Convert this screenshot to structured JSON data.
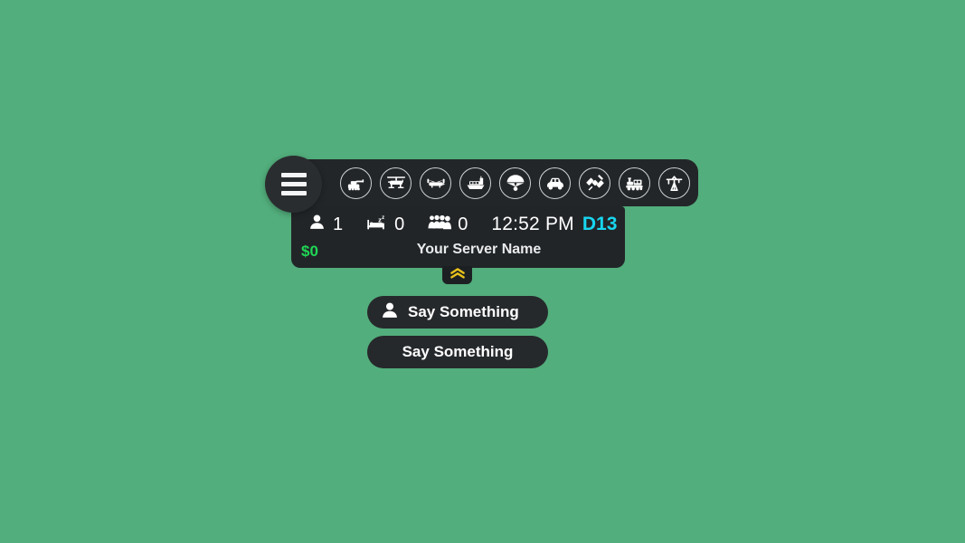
{
  "theme": {
    "background": "#52ae7c",
    "panel": "#232629",
    "panel_dark": "#222528",
    "accent_cyan": "#18d6ef",
    "accent_green": "#1fd655",
    "accent_yellow": "#e8c21a",
    "text": "#ffffff"
  },
  "menu": {
    "name": "hamburger-menu",
    "label": "Menu"
  },
  "topbar": {
    "items": [
      {
        "icon": "tank-icon",
        "label": "Tank"
      },
      {
        "icon": "helicopter-icon",
        "label": "Helicopter"
      },
      {
        "icon": "transport-helicopter-icon",
        "label": "Transport Helicopter"
      },
      {
        "icon": "ship-icon",
        "label": "Ship"
      },
      {
        "icon": "parachute-icon",
        "label": "Parachute"
      },
      {
        "icon": "car-icon",
        "label": "Car"
      },
      {
        "icon": "satellite-icon",
        "label": "Satellite"
      },
      {
        "icon": "train-icon",
        "label": "Train"
      },
      {
        "icon": "crane-icon",
        "label": "Crane"
      }
    ]
  },
  "info": {
    "stats": [
      {
        "icon": "person-icon",
        "value": "1"
      },
      {
        "icon": "bed-sleep-icon",
        "value": "0"
      },
      {
        "icon": "group-people-icon",
        "value": "0"
      }
    ],
    "clock": "12:52 PM",
    "day": "D13",
    "money": "$0",
    "server_name": "Your Server Name"
  },
  "collapse": {
    "icon": "double-chevron-up-icon",
    "label": "Collapse"
  },
  "chat": {
    "buttons": [
      {
        "icon": "person-icon",
        "label": "Say Something"
      },
      {
        "icon": null,
        "label": "Say Something"
      }
    ]
  }
}
